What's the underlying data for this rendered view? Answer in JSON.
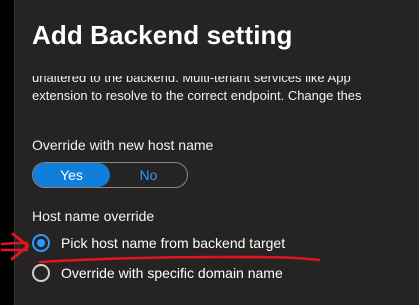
{
  "dialog": {
    "title": "Add Backend setting",
    "description_lines": [
      "unaltered to the backend. Multi-tenant services like App",
      "extension to resolve to the correct endpoint. Change thes"
    ]
  },
  "override_host": {
    "label": "Override with new host name",
    "options": [
      "Yes",
      "No"
    ],
    "selected": "Yes"
  },
  "host_override": {
    "label": "Host name override",
    "options": [
      {
        "label": "Pick host name from backend target",
        "checked": true
      },
      {
        "label": "Override with specific domain name",
        "checked": false
      }
    ]
  },
  "colors": {
    "panel_bg": "#252423",
    "accent": "#0f7fdb",
    "link_blue": "#2b99ff",
    "annotation_red": "#e0141e"
  },
  "annotation": {
    "arrow_icon": "red-arrow-icon",
    "underline": "red-underline-icon"
  }
}
